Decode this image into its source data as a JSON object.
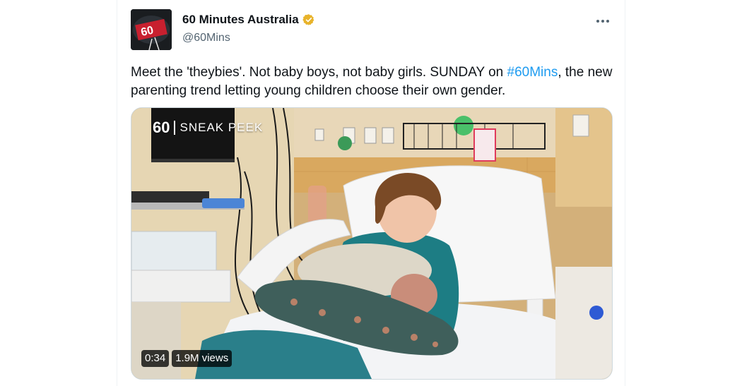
{
  "author": {
    "name": "60 Minutes Australia",
    "handle": "@60Mins",
    "avatar_icon": "60-minutes-logo",
    "verified_color": "#e8b32b"
  },
  "tweet": {
    "text_before": "Meet the 'theybies'. Not baby boys, not baby girls. SUNDAY on ",
    "hashtag": "#60Mins",
    "text_after": ", the new parenting trend letting young children choose their own gender."
  },
  "media": {
    "watermark_logo": "60",
    "watermark_text": "SNEAK PEEK",
    "duration": "0:34",
    "views": "1.9M views"
  },
  "colors": {
    "hashtag": "#1d9bf0",
    "text": "#0f1419",
    "muted": "#536471"
  }
}
